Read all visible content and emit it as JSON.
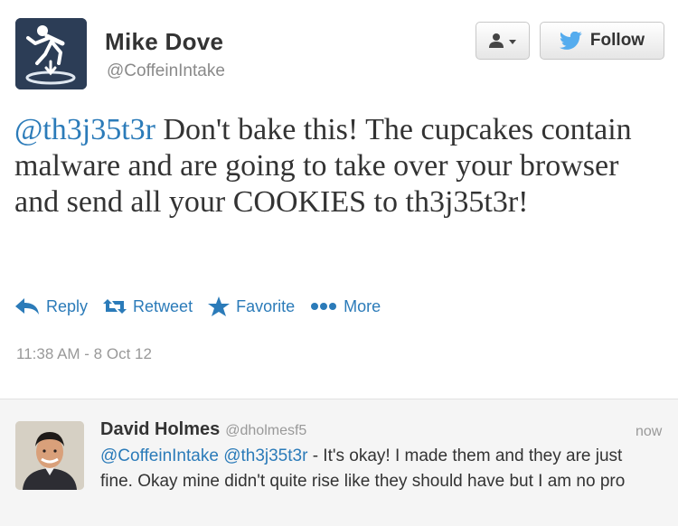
{
  "tweet": {
    "author_name": "Mike Dove",
    "author_handle": "@CoffeinIntake",
    "follow_label": "Follow",
    "mention": "@th3j35t3r",
    "body": " Don't bake this! The cupcakes contain malware and are going to take over your browser and send all your COOKIES to th3j35t3r!",
    "actions": {
      "reply": "Reply",
      "retweet": "Retweet",
      "favorite": "Favorite",
      "more": "More"
    },
    "timestamp": "11:38 AM - 8 Oct 12"
  },
  "reply": {
    "author_name": "David Holmes",
    "author_handle": "@dholmesf5",
    "time": "now",
    "mention1": "@CoffeinIntake",
    "mention2": "@th3j35t3r",
    "body": " - It's okay! I made them and they are just fine. Okay mine didn't quite rise like they should have but I am no pro"
  },
  "colors": {
    "link": "#2b7bb9",
    "twitter_bird": "#55acee",
    "muted": "#999999",
    "reply_background": "#f5f5f5"
  },
  "icons": {
    "avatar": "portal-figure-avatar",
    "user_menu": "user-icon",
    "follow": "twitter-bird-icon",
    "reply": "reply-arrow-icon",
    "retweet": "retweet-icon",
    "favorite": "star-icon",
    "more": "dots-icon"
  }
}
